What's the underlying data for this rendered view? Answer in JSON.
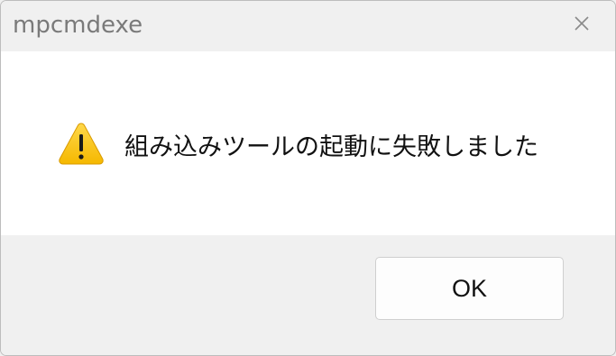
{
  "window": {
    "title": "mpcmdexe"
  },
  "icons": {
    "close": "close-icon",
    "warning": "warning-icon"
  },
  "message": {
    "text": "組み込みツールの起動に失敗しました"
  },
  "buttons": {
    "ok_label": "OK"
  },
  "colors": {
    "background": "#f0f0f0",
    "content_background": "#ffffff",
    "warning_fill": "#fcc419",
    "warning_mark": "#1a1a1a"
  }
}
